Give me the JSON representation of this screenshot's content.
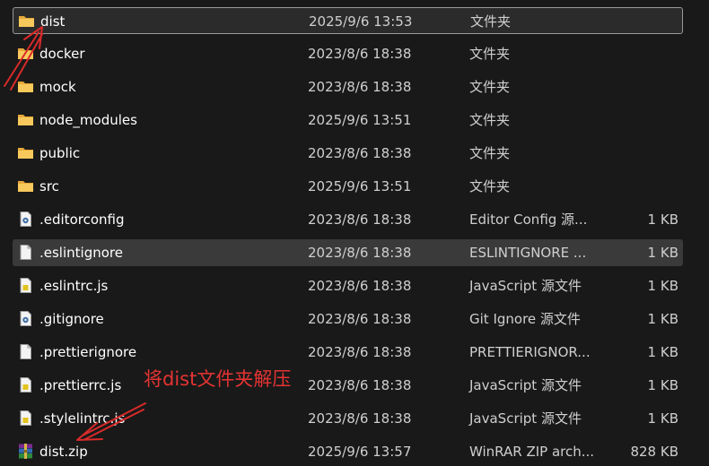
{
  "files": [
    {
      "name": "dist",
      "date": "2025/9/6 13:53",
      "type": "文件夹",
      "size": "",
      "icon": "folder-icon"
    },
    {
      "name": "docker",
      "date": "2023/8/6 18:38",
      "type": "文件夹",
      "size": "",
      "icon": "folder-icon"
    },
    {
      "name": "mock",
      "date": "2023/8/6 18:38",
      "type": "文件夹",
      "size": "",
      "icon": "folder-icon"
    },
    {
      "name": "node_modules",
      "date": "2025/9/6 13:51",
      "type": "文件夹",
      "size": "",
      "icon": "folder-icon"
    },
    {
      "name": "public",
      "date": "2023/8/6 18:38",
      "type": "文件夹",
      "size": "",
      "icon": "folder-icon"
    },
    {
      "name": "src",
      "date": "2025/9/6 13:51",
      "type": "文件夹",
      "size": "",
      "icon": "folder-icon"
    },
    {
      "name": ".editorconfig",
      "date": "2023/8/6 18:38",
      "type": "Editor Config 源...",
      "size": "1 KB",
      "icon": "gear-file-icon"
    },
    {
      "name": ".eslintignore",
      "date": "2023/8/6 18:38",
      "type": "ESLINTIGNORE ...",
      "size": "1 KB",
      "icon": "file-icon"
    },
    {
      "name": ".eslintrc.js",
      "date": "2023/8/6 18:38",
      "type": "JavaScript 源文件",
      "size": "1 KB",
      "icon": "js-file-icon"
    },
    {
      "name": ".gitignore",
      "date": "2023/8/6 18:38",
      "type": "Git Ignore 源文件",
      "size": "1 KB",
      "icon": "gear-file-icon"
    },
    {
      "name": ".prettierignore",
      "date": "2023/8/6 18:38",
      "type": "PRETTIERIGNOR...",
      "size": "1 KB",
      "icon": "file-icon"
    },
    {
      "name": ".prettierrc.js",
      "date": "2023/8/6 18:38",
      "type": "JavaScript 源文件",
      "size": "1 KB",
      "icon": "js-file-icon"
    },
    {
      "name": ".stylelintrc.js",
      "date": "2023/8/6 18:38",
      "type": "JavaScript 源文件",
      "size": "1 KB",
      "icon": "js-file-icon"
    },
    {
      "name": "dist.zip",
      "date": "2025/9/6 13:57",
      "type": "WinRAR ZIP arch...",
      "size": "828 KB",
      "icon": "winrar-archive-icon"
    }
  ],
  "annotation": {
    "text": "将dist文件夹解压",
    "color": "#e53333"
  }
}
